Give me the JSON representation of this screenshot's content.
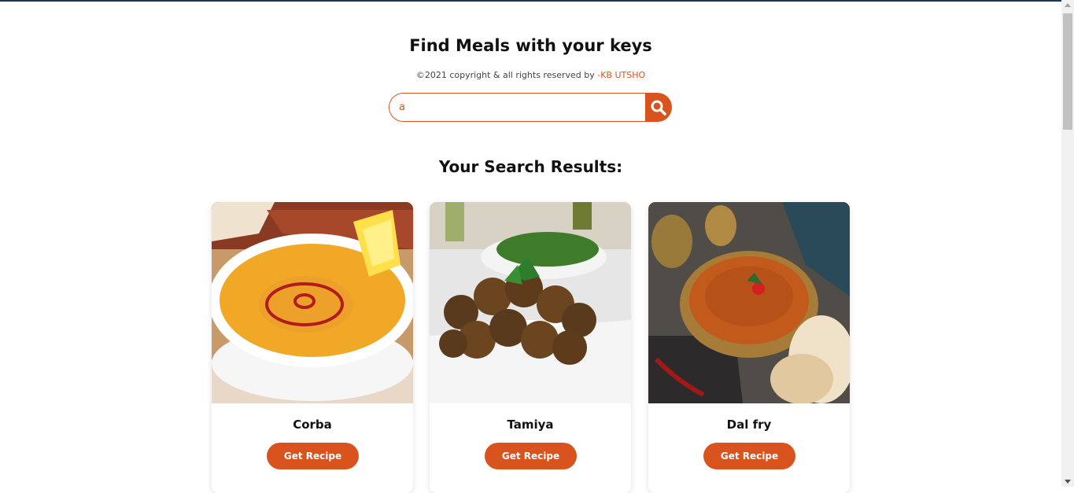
{
  "header": {
    "title": "Find Meals with your keys",
    "copyright_prefix": "©2021 copyright & all rights reserved by ",
    "copyright_author": "-KB UTSHO"
  },
  "search": {
    "value": "a",
    "icon": "search-icon"
  },
  "results": {
    "heading": "Your Search Results:",
    "items": [
      {
        "title": "Corba",
        "button_label": "Get Recipe"
      },
      {
        "title": "Tamiya",
        "button_label": "Get Recipe"
      },
      {
        "title": "Dal fry",
        "button_label": "Get Recipe"
      }
    ]
  },
  "colors": {
    "accent": "#d9531e",
    "top_border": "#1d3557"
  }
}
